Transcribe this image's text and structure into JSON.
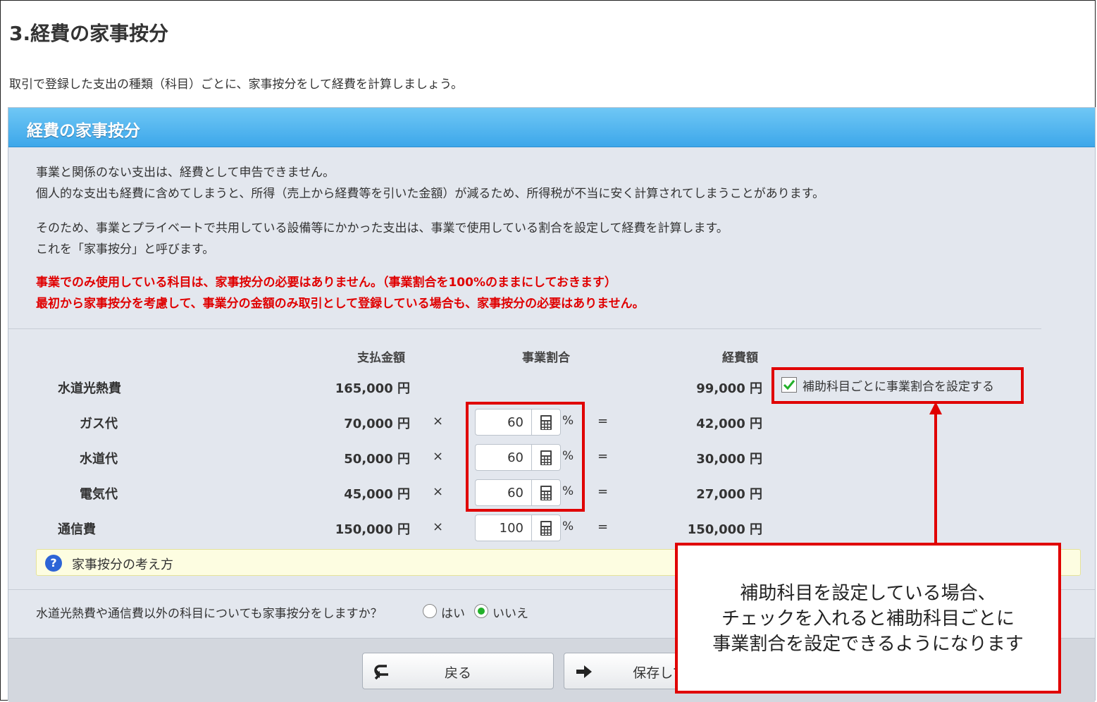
{
  "page_title": "3.経費の家事按分",
  "intro": "取引で登録した支出の種類（科目）ごとに、家事按分をして経費を計算しましょう。",
  "panel": {
    "title": "経費の家事按分",
    "para1_line1": "事業と関係のない支出は、経費として申告できません。",
    "para1_line2": "個人的な支出も経費に含めてしまうと、所得（売上から経費等を引いた金額）が減るため、所得税が不当に安く計算されてしまうことがあります。",
    "para2_line1": "そのため、事業とプライベートで共用している設備等にかかった支出は、事業で使用している割合を設定して経費を計算します。",
    "para2_line2": "これを「家事按分」と呼びます。",
    "warn_line1": "事業でのみ使用している科目は、家事按分の必要はありません。（事業割合を100%のままにしておきます）",
    "warn_line2": "最初から家事按分を考慮して、事業分の金額のみ取引として登録している場合も、家事按分の必要はありません。"
  },
  "table": {
    "headers": {
      "paid": "支払金額",
      "rate": "事業割合",
      "expense": "経費額"
    },
    "times": "×",
    "equals": "=",
    "percent": "%",
    "rows": [
      {
        "name": "水道光熱費",
        "paid": "165,000 円",
        "expense": "99,000 円"
      },
      {
        "name": "ガス代",
        "paid": "70,000 円",
        "rate": "60",
        "expense": "42,000 円"
      },
      {
        "name": "水道代",
        "paid": "50,000 円",
        "rate": "60",
        "expense": "30,000 円"
      },
      {
        "name": "電気代",
        "paid": "45,000 円",
        "rate": "60",
        "expense": "27,000 円"
      },
      {
        "name": "通信費",
        "paid": "150,000 円",
        "rate": "100",
        "expense": "150,000 円"
      }
    ]
  },
  "checkbox_label": "補助科目ごとに事業割合を設定する",
  "help_link": "家事按分の考え方",
  "question": {
    "text": "水道光熱費や通信費以外の科目についても家事按分をしますか？",
    "yes": "はい",
    "no": "いいえ"
  },
  "buttons": {
    "back": "戻る",
    "save": "保存して"
  },
  "callout": {
    "line1": "補助科目を設定している場合、",
    "line2": "チェックを入れると補助科目ごとに",
    "line3": "事業割合を設定できるようになります"
  },
  "colors": {
    "accent": "#3da7ea",
    "annotation_red": "#e00000",
    "check_green": "#22b02a"
  }
}
